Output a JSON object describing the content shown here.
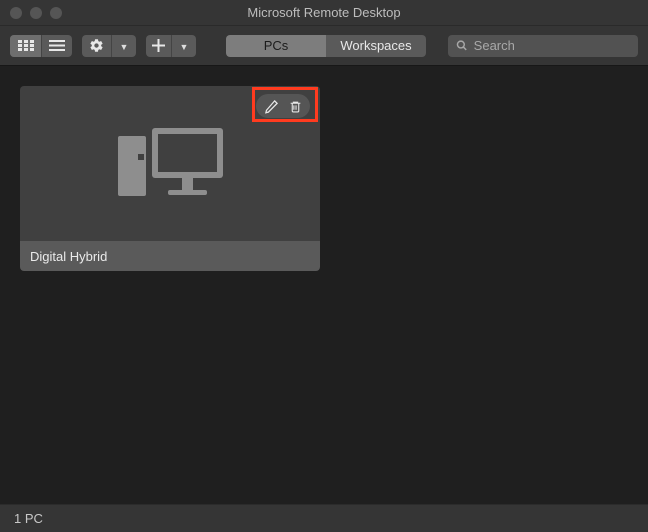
{
  "window": {
    "title": "Microsoft Remote Desktop"
  },
  "toolbar": {
    "tabs": {
      "pcs": "PCs",
      "workspaces": "Workspaces"
    }
  },
  "search": {
    "placeholder": "Search"
  },
  "pcs": [
    {
      "name": "Digital Hybrid"
    }
  ],
  "status": {
    "count_label": "1 PC"
  }
}
